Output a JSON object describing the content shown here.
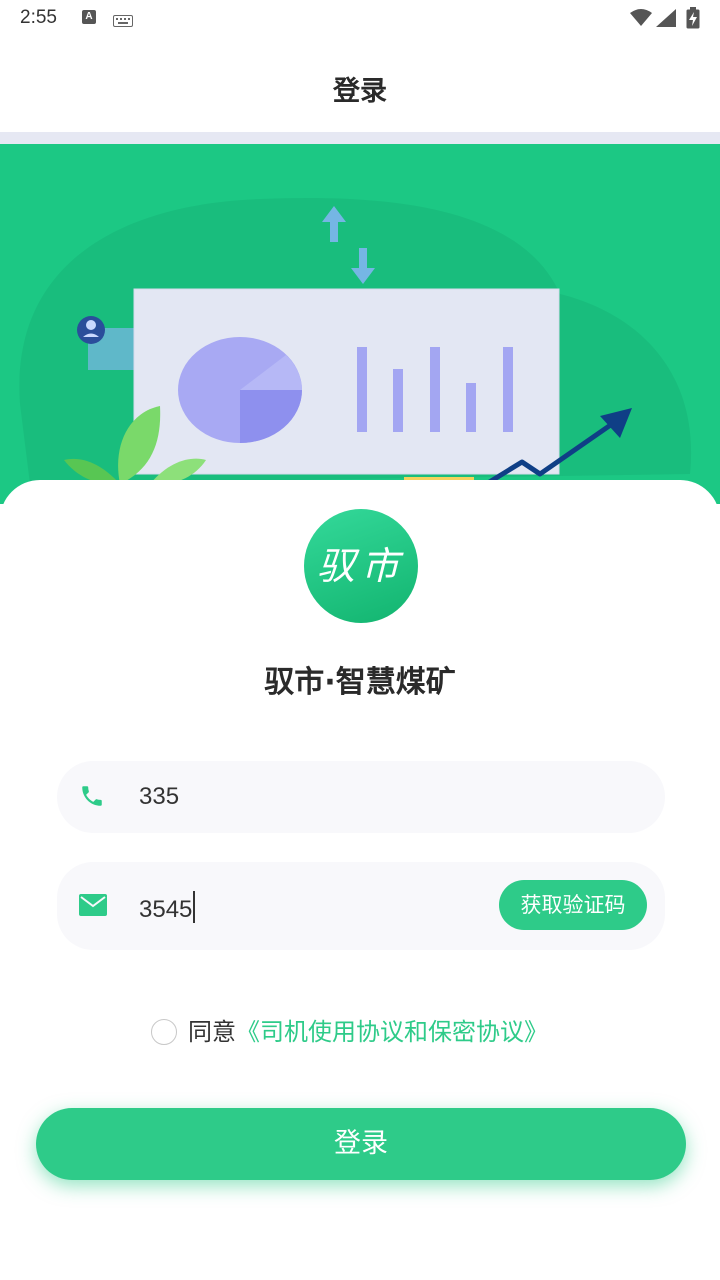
{
  "status_bar": {
    "time": "2:55",
    "notification_icon": "A"
  },
  "header": {
    "title": "登录"
  },
  "logo": {
    "text": "驭市"
  },
  "app": {
    "name": "驭市·智慧煤矿"
  },
  "form": {
    "phone": {
      "value": "335",
      "icon": "phone-icon"
    },
    "code": {
      "value": "3545",
      "icon": "mail-icon",
      "button_label": "获取验证码"
    }
  },
  "agreement": {
    "checked": false,
    "prefix": "同意",
    "link_text": "《司机使用协议和保密协议》"
  },
  "login_button": {
    "label": "登录"
  },
  "colors": {
    "brand": "#2ecb89",
    "hero": "#1cc884",
    "navy_arrow": "#0f3f86"
  }
}
